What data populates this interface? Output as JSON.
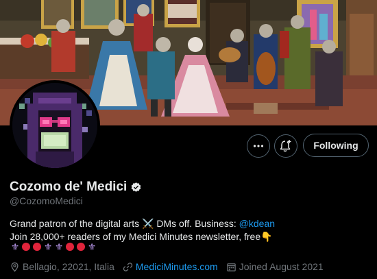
{
  "profile": {
    "display_name": "Cozomo de' Medici",
    "handle": "@CozomoMedici",
    "bio_line1_text": "Grand patron of the digital arts ⚔️ DMs off. Business: ",
    "bio_line1_mention": "@kdean",
    "bio_line2": "Join 28,000+ readers of my Medici Minutes newsletter, free👇",
    "emoji_sequence": [
      "⚜",
      "●",
      "●",
      "⚜",
      "⚜",
      "●",
      "●",
      "⚜"
    ],
    "location": "Bellagio, 22021, Italia",
    "website": "MediciMinutes.com",
    "joined": "Joined August 2021"
  },
  "actions": {
    "more_icon": "ellipsis-icon",
    "notify_icon": "bell-plus-icon",
    "follow_label": "Following"
  },
  "colors": {
    "accent": "#1d9bf0",
    "secondary_text": "#71767b",
    "background": "#000000",
    "heart_red": "#e0243b",
    "fleur_purple": "#b695e8"
  }
}
